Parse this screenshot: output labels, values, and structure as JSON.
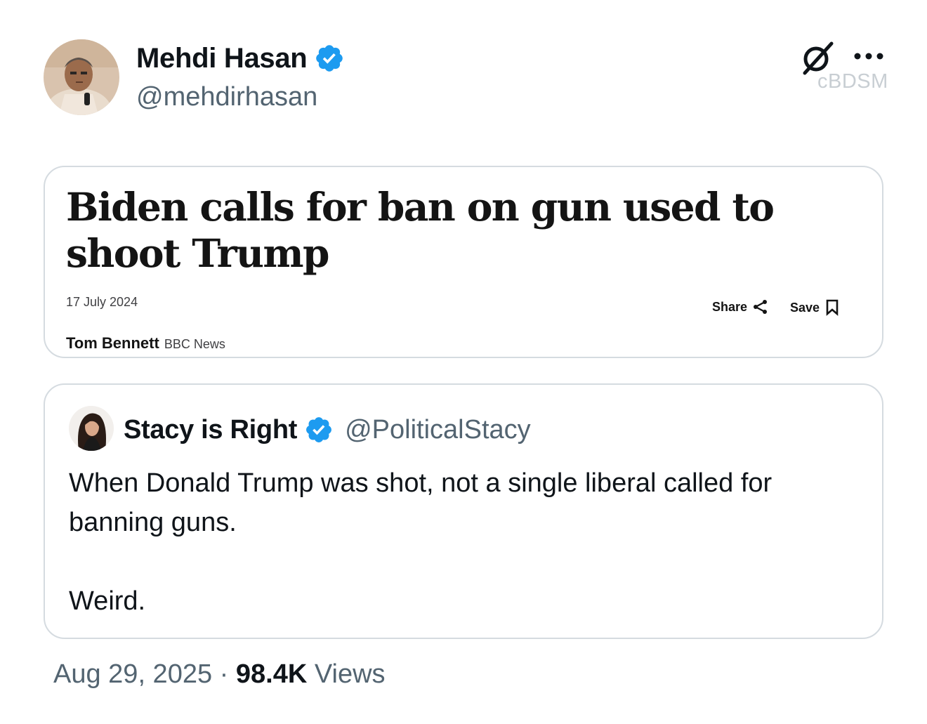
{
  "post": {
    "author_name": "Mehdi Hasan",
    "author_handle": "@mehdirhasan",
    "watermark": "cBDSM",
    "date": "Aug 29, 2025",
    "separator": "·",
    "views_count": "98.4K",
    "views_label": "Views"
  },
  "article": {
    "headline": "Biden calls for ban on gun used to shoot Trump",
    "date": "17 July 2024",
    "author": "Tom Bennett",
    "outlet": "BBC News",
    "share_label": "Share",
    "save_label": "Save"
  },
  "quote": {
    "name": "Stacy is Right",
    "handle": "@PoliticalStacy",
    "line1": "When Donald Trump was shot, not a single liberal called for banning guns.",
    "line2": "Weird."
  },
  "colors": {
    "verified": "#1d9bf0",
    "secondary_text": "#536471",
    "border": "#d5dbe0"
  },
  "icons": [
    "verified-badge-icon",
    "grok-icon",
    "more-icon",
    "share-icon",
    "bookmark-icon"
  ]
}
